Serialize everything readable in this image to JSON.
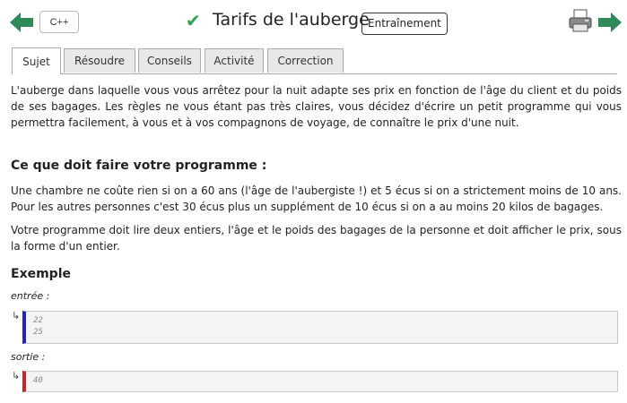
{
  "header": {
    "language_label": "C++",
    "title": "Tarifs de l'auberge",
    "badge": "Entraînement",
    "status_icon": "check-icon",
    "accent_color": "#2e8b57"
  },
  "tabs": [
    {
      "label": "Sujet",
      "active": true
    },
    {
      "label": "Résoudre",
      "active": false
    },
    {
      "label": "Conseils",
      "active": false
    },
    {
      "label": "Activité",
      "active": false
    },
    {
      "label": "Correction",
      "active": false
    }
  ],
  "statement": {
    "intro": "L'auberge dans laquelle vous vous arrêtez pour la nuit adapte ses prix en fonction de l'âge du client et du poids de ses bagages. Les règles ne vous étant pas très claires, vous décidez d'écrire un petit programme qui vous permettra facilement, à vous et à vos compagnons de voyage, de connaître le prix d'une nuit.",
    "section_title": "Ce que doit faire votre programme :",
    "rules": "Une chambre ne coûte rien si on a 60 ans (l'âge de l'aubergiste !) et 5 écus si on a strictement moins de 10 ans. Pour les autres personnes c'est 30 écus plus un supplément de 10 écus si on a au moins 20 kilos de bagages.",
    "io_desc": "Votre programme doit lire deux entiers, l'âge et le poids des bagages de la personne et doit afficher le prix, sous la forme d'un entier."
  },
  "example": {
    "title": "Exemple",
    "input_label": "entrée :",
    "input_lines": [
      "22",
      "25"
    ],
    "output_label": "sortie :",
    "output_lines": [
      "40"
    ],
    "arrow": "↳"
  }
}
